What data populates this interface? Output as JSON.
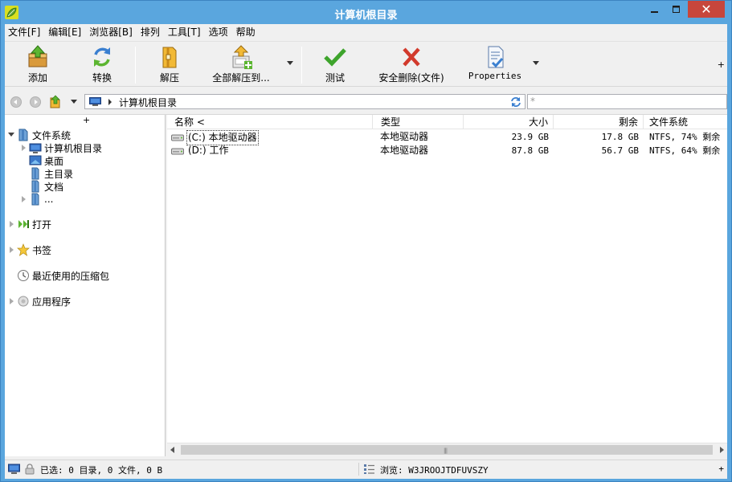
{
  "window": {
    "title": "计算机根目录",
    "close_glyph": "✕",
    "colors": {
      "frame": "#5aa6de",
      "close": "#c7463c"
    }
  },
  "menu": [
    "文件[F]",
    "编辑[E]",
    "浏览器[B]",
    "排列",
    "工具[T]",
    "选项",
    "帮助"
  ],
  "toolbar": {
    "add": "添加",
    "convert": "转换",
    "extract": "解压",
    "extract_all": "全部解压到...",
    "test": "测试",
    "secure_delete": "安全删除(文件)",
    "properties": "Properties",
    "plus": "+"
  },
  "address": {
    "path": "计算机根目录",
    "filter_placeholder": "*"
  },
  "tree": {
    "plus": "+",
    "root": "文件系统",
    "items": [
      "计算机根目录",
      "桌面",
      "主目录",
      "文档",
      "..."
    ],
    "sections": [
      "打开",
      "书签",
      "最近使用的压缩包",
      "应用程序"
    ]
  },
  "list": {
    "headers": {
      "name": "名称 <",
      "type": "类型",
      "size": "大小",
      "free": "剩余",
      "fs": "文件系统"
    },
    "rows": [
      {
        "name": "(C:) 本地驱动器",
        "type": "本地驱动器",
        "size": "23.9 GB",
        "free": "17.8 GB",
        "fs": "NTFS, 74% 剩余"
      },
      {
        "name": "(D:) 工作",
        "type": "本地驱动器",
        "size": "87.8 GB",
        "free": "56.7 GB",
        "fs": "NTFS, 64% 剩余"
      }
    ]
  },
  "status": {
    "selection": "已选: 0 目录, 0 文件, 0 B",
    "browse": "浏览: W3JROOJTDFUVSZY",
    "plus": "+"
  }
}
